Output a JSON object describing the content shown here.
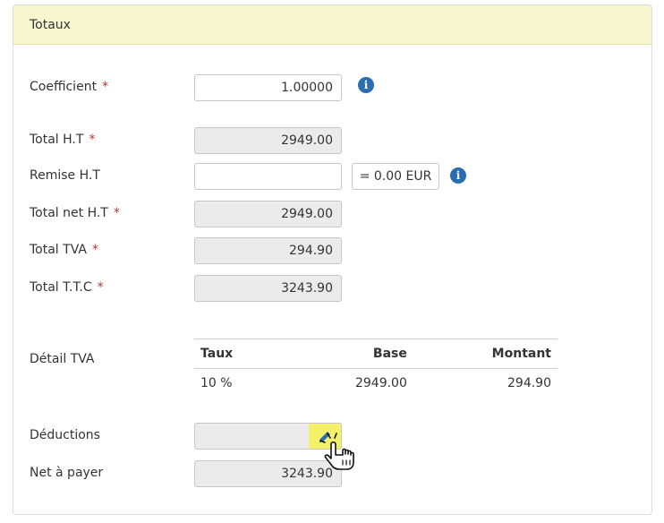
{
  "panel": {
    "title": "Totaux"
  },
  "fields": {
    "coefficient": {
      "label": "Coefficient",
      "value": "1.00000"
    },
    "total_ht": {
      "label": "Total H.T",
      "value": "2949.00"
    },
    "remise_ht": {
      "label": "Remise H.T",
      "value": "",
      "equals_text": "= 0.00 EUR"
    },
    "total_net_ht": {
      "label": "Total net H.T",
      "value": "2949.00"
    },
    "total_tva": {
      "label": "Total TVA",
      "value": "294.90"
    },
    "total_ttc": {
      "label": "Total T.T.C",
      "value": "3243.90"
    },
    "detail_tva": {
      "label": "Détail TVA"
    },
    "deductions": {
      "label": "Déductions",
      "value": ""
    },
    "net_a_payer": {
      "label": "Net à payer",
      "value": "3243.90"
    }
  },
  "required_mark": "*",
  "vat_table": {
    "headers": [
      "Taux",
      "Base",
      "Montant"
    ],
    "rows": [
      [
        "10 %",
        "2949.00",
        "294.90"
      ]
    ]
  },
  "icons": [
    "info-icon",
    "pencil-icon",
    "hand-pointer-icon"
  ],
  "colors": {
    "heading_bg": "#f7f6cf",
    "required": "#bb3333",
    "info": "#2a6db0",
    "edit_button": "#f5f06a",
    "readonly_bg": "#ebebeb"
  }
}
